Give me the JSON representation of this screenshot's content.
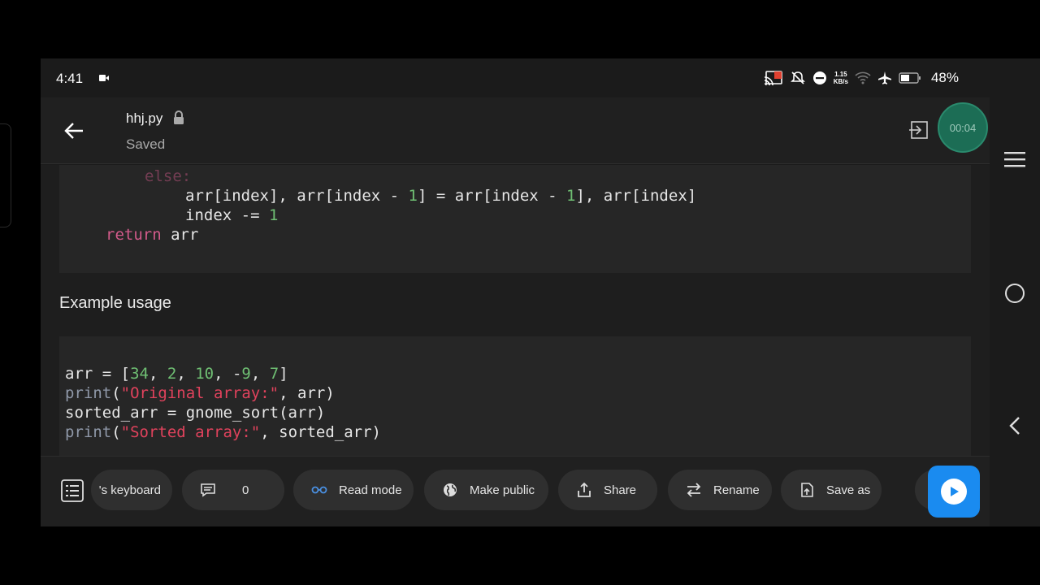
{
  "status_bar": {
    "time": "4:41",
    "net_speed_value": "1.15",
    "net_speed_unit": "KB/s",
    "battery": "48%"
  },
  "app_bar": {
    "file_name": "hhj.py",
    "save_status": "Saved",
    "timer": "00:04"
  },
  "code_block_1": {
    "line_1": "else:",
    "line_2": {
      "a": "arr[index], arr[index - ",
      "n1": "1",
      "b": "] = arr[index - ",
      "n2": "1",
      "c": "], arr[index]"
    },
    "line_3": {
      "a": "index -= ",
      "n": "1"
    },
    "line_4": {
      "kw": "return",
      "rest": " arr"
    }
  },
  "section_heading": "Example usage",
  "code_block_2": {
    "line_1": {
      "a": "arr = [",
      "n1": "34",
      "s1": ", ",
      "n2": "2",
      "s2": ", ",
      "n3": "10",
      "s3": ", -",
      "n4": "9",
      "s4": ", ",
      "n5": "7",
      "z": "]"
    },
    "line_2": {
      "fn": "print",
      "p": "(",
      "str": "\"Original array:\"",
      "rest": ", arr)"
    },
    "line_3": "sorted_arr = gnome_sort(arr)",
    "line_4": {
      "fn": "print",
      "p": "(",
      "str": "\"Sorted array:\"",
      "rest": ", sorted_arr)"
    }
  },
  "toolbar": {
    "keyboard_label": "'s keyboard",
    "comments_count": "0",
    "read_mode_label": "Read mode",
    "make_public_label": "Make public",
    "share_label": "Share",
    "rename_label": "Rename",
    "save_as_label": "Save as"
  },
  "colors": {
    "background": "#1b1b1b",
    "code_bg": "#262626",
    "keyword": "#d25a8a",
    "number": "#6fbf73",
    "string": "#e0425c",
    "run_button": "#1a8bf0",
    "timer_bg": "#1c6d55"
  },
  "icons": {
    "back": "arrow-left-icon",
    "lock": "lock-icon",
    "exit": "exit-icon",
    "menu": "hamburger-menu-icon",
    "outline": "list-outline-icon",
    "comment": "comment-icon",
    "read_mode": "glasses-icon",
    "globe": "globe-icon",
    "share": "share-upload-icon",
    "rename": "swap-arrows-icon",
    "save_as": "save-as-icon",
    "delete": "trash-icon",
    "run": "play-icon"
  }
}
